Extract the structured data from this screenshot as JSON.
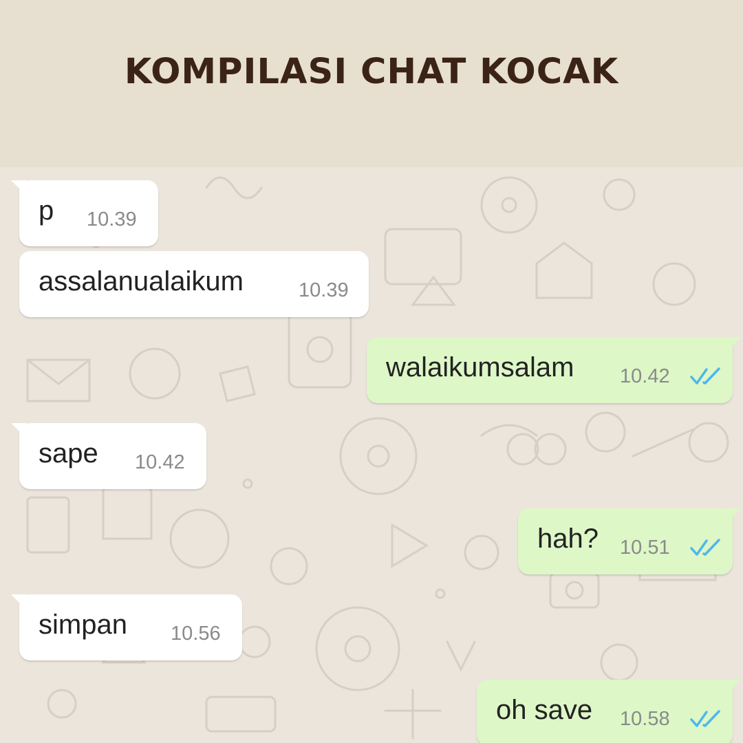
{
  "header": {
    "title": "KOMPILASI CHAT KOCAK"
  },
  "colors": {
    "header_bg": "#e7e0d1",
    "title_color": "#3b2417",
    "chat_bg": "#ebe5dc",
    "incoming_bubble": "#ffffff",
    "outgoing_bubble": "#ddf7c7",
    "read_ticks": "#4fb6ec"
  },
  "messages": [
    {
      "direction": "incoming",
      "text": "p",
      "time": "10.39"
    },
    {
      "direction": "incoming",
      "text": "assalanualaikum",
      "time": "10.39"
    },
    {
      "direction": "outgoing",
      "text": "walaikumsalam",
      "time": "10.42",
      "status": "read-double-check-icon"
    },
    {
      "direction": "incoming",
      "text": "sape",
      "time": "10.42"
    },
    {
      "direction": "outgoing",
      "text": "hah?",
      "time": "10.51",
      "status": "read-double-check-icon"
    },
    {
      "direction": "incoming",
      "text": "simpan",
      "time": "10.56"
    },
    {
      "direction": "outgoing",
      "text": "oh save",
      "time": "10.58",
      "status": "read-double-check-icon"
    }
  ]
}
